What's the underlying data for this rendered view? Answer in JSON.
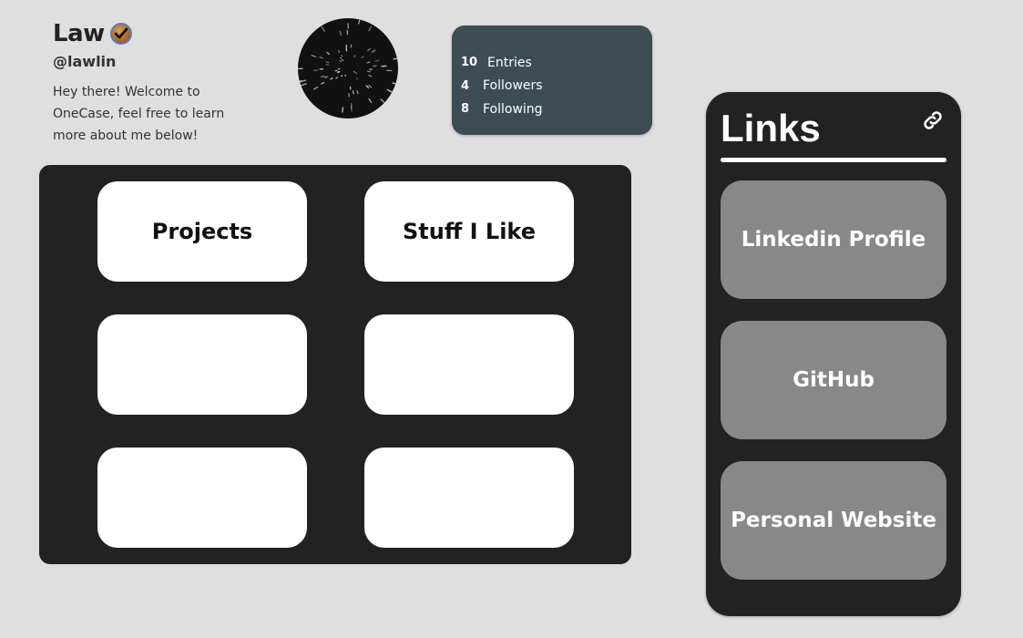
{
  "profile": {
    "name": "Law",
    "verified_icon": "verified-badge-icon",
    "handle": "@lawlin",
    "bio": "Hey there! Welcome to OneCase, feel free to learn more about me below!"
  },
  "avatar": {
    "icon": "starfield-avatar"
  },
  "stats": [
    {
      "value": "10",
      "label": "Entries"
    },
    {
      "value": "4",
      "label": "Followers"
    },
    {
      "value": "8",
      "label": "Following"
    }
  ],
  "tiles": [
    {
      "label": "Projects"
    },
    {
      "label": "Stuff I Like"
    },
    {
      "label": ""
    },
    {
      "label": ""
    },
    {
      "label": ""
    },
    {
      "label": ""
    }
  ],
  "links": {
    "title": "Links",
    "icon": "link-icon",
    "items": [
      {
        "label": "Linkedin Profile"
      },
      {
        "label": "GitHub"
      },
      {
        "label": "Personal Website"
      }
    ]
  },
  "colors": {
    "background": "#e0dfe0",
    "panel_dark": "#222222",
    "stats_bg": "#3d4c53",
    "link_button": "#888888",
    "tile": "#ffffff"
  }
}
